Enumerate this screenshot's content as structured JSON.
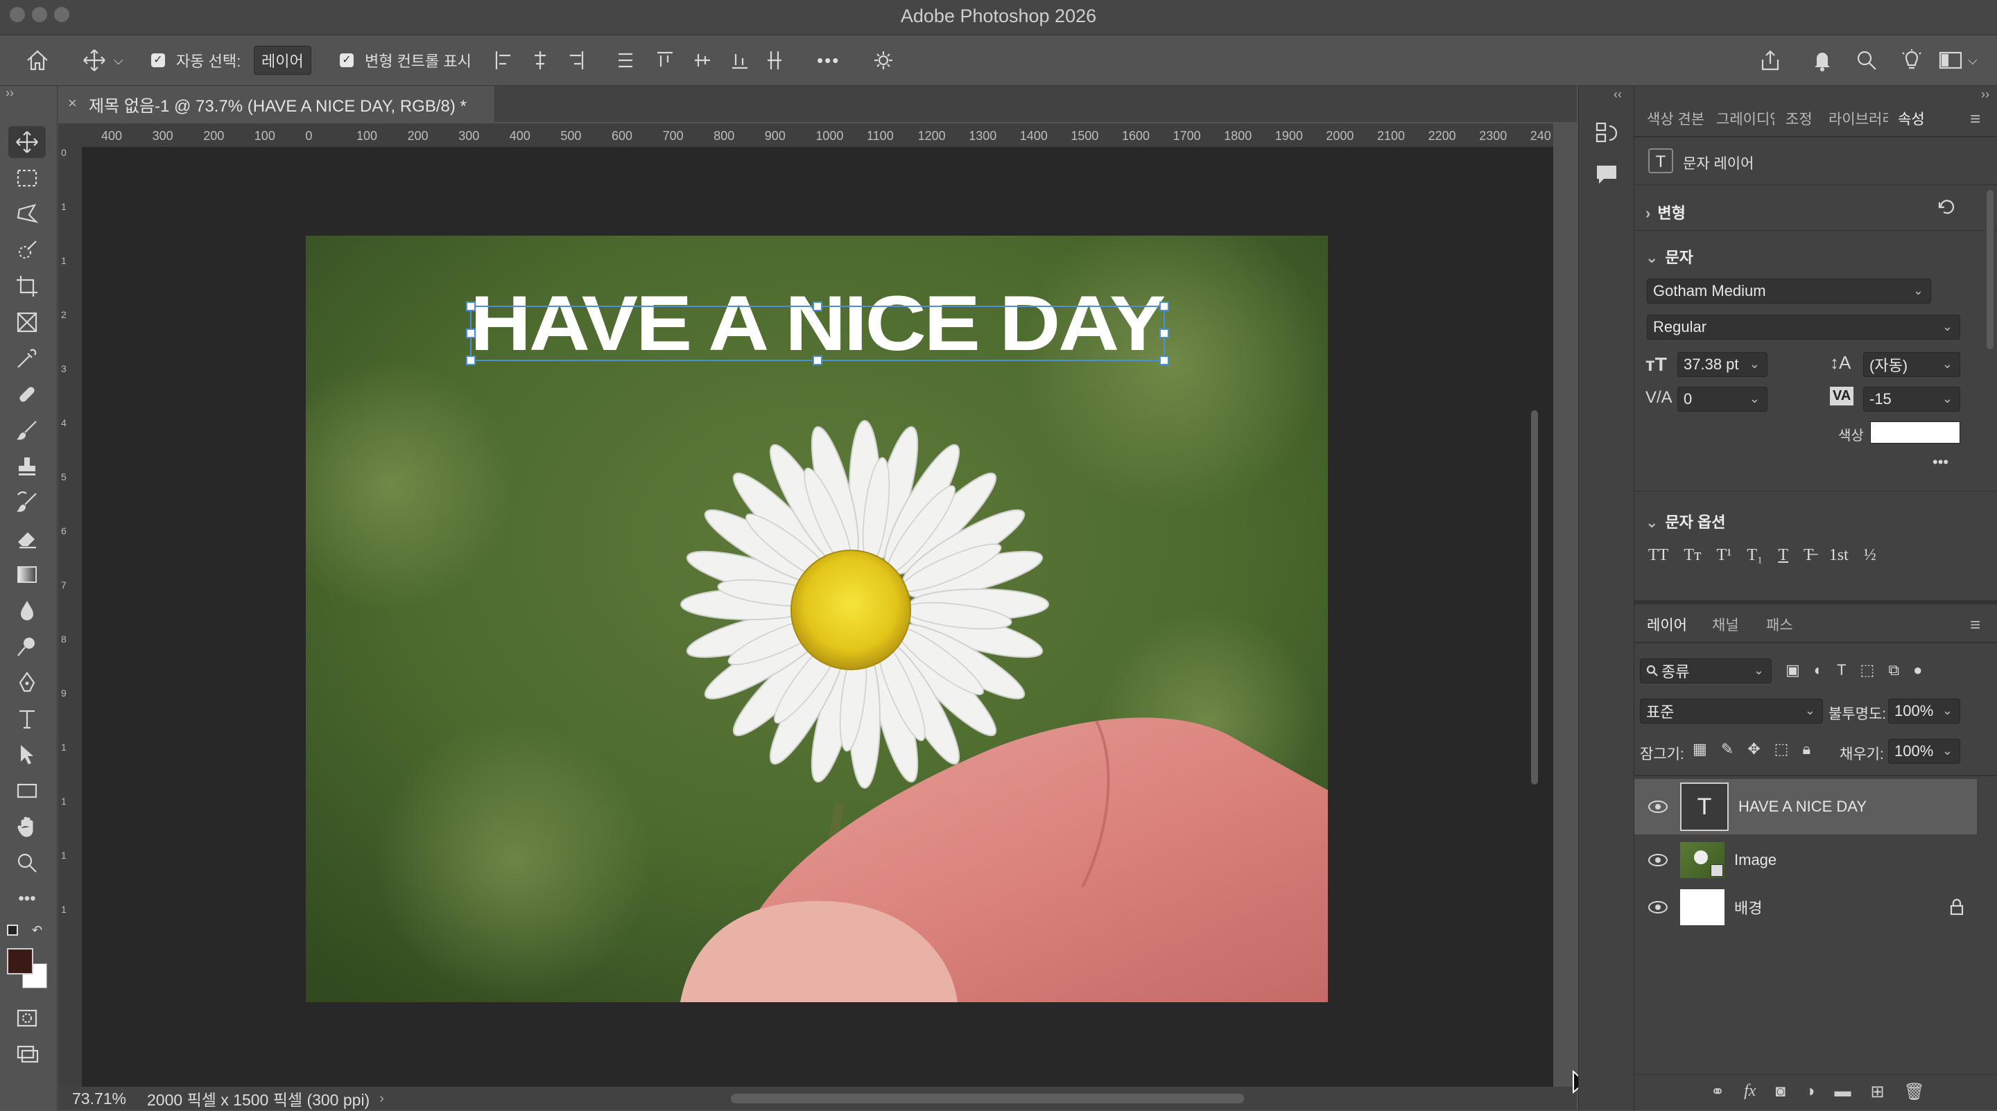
{
  "window": {
    "title": "Adobe Photoshop 2026"
  },
  "options_bar": {
    "auto_select_label": "자동 선택:",
    "auto_select_value": "레이어",
    "show_transform_label": "변형 컨트롤 표시",
    "more_label": "•••"
  },
  "document": {
    "tab_title": "제목 없음-1 @ 73.7% (HAVE A NICE DAY, RGB/8) *",
    "canvas_text": "HAVE A NICE DAY",
    "ruler_h": [
      "400",
      "300",
      "200",
      "100",
      "0",
      "100",
      "200",
      "300",
      "400",
      "500",
      "600",
      "700",
      "800",
      "900",
      "1000",
      "1100",
      "1200",
      "1300",
      "1400",
      "1500",
      "1600",
      "1700",
      "1800",
      "1900",
      "2000",
      "2100",
      "2200",
      "2300",
      "240"
    ],
    "ruler_v": [
      "0",
      "1",
      "1",
      "2",
      "3",
      "4",
      "5",
      "6",
      "7",
      "8",
      "9",
      "1",
      "1",
      "1",
      "1"
    ],
    "status_zoom": "73.71%",
    "status_info": "2000 픽셀 x 1500 픽셀 (300 ppi)"
  },
  "panel_tabs": [
    "색상 견본",
    "그레이디언",
    "조정",
    "라이브러리",
    "속성"
  ],
  "properties": {
    "layer_kind": "문자 레이어",
    "transform_section": "변형",
    "character_section": "문자",
    "font_family": "Gotham Medium",
    "font_style": "Regular",
    "font_size": "37.38 pt",
    "leading": "(자동)",
    "kerning": "0",
    "tracking": "-15",
    "color_label": "색상",
    "text_color": "#ffffff",
    "more": "•••",
    "char_options_section": "문자 옵션",
    "char_option_glyphs": [
      "TT",
      "Tт",
      "T¹",
      "T₁",
      "T",
      "T̶",
      "1st",
      "½"
    ]
  },
  "layers_panel": {
    "tabs": [
      "레이어",
      "채널",
      "패스"
    ],
    "filter_label": "종류",
    "blend_mode": "표준",
    "opacity_label": "불투명도:",
    "opacity_value": "100%",
    "lock_label": "잠그기:",
    "fill_label": "채우기:",
    "fill_value": "100%",
    "layers": [
      {
        "name": "HAVE A NICE DAY",
        "type": "text",
        "selected": true
      },
      {
        "name": "Image",
        "type": "image",
        "selected": false
      },
      {
        "name": "배경",
        "type": "background",
        "selected": false,
        "locked": true
      }
    ]
  },
  "colors": {
    "foreground": "#3a1a14",
    "background": "#ffffff",
    "accent": "#4a90d9"
  }
}
